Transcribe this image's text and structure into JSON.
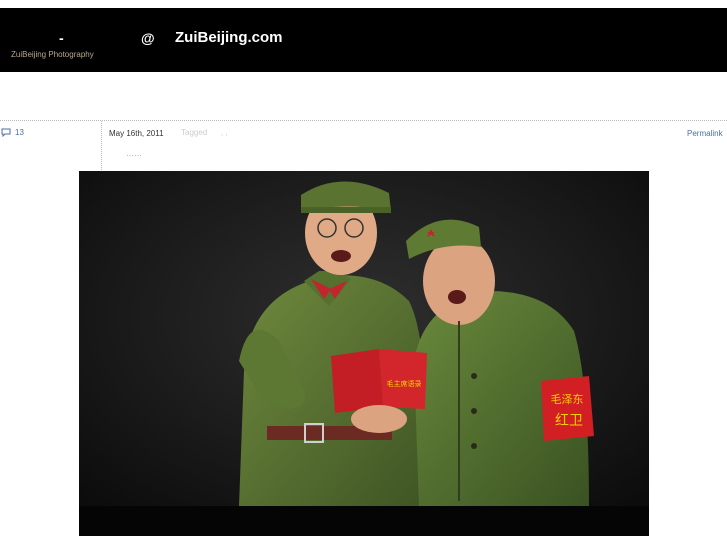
{
  "header": {
    "dash": "-",
    "subtitle": "ZuiBeijing Photography",
    "at": "@",
    "site_name": "ZuiBeijing.com"
  },
  "post": {
    "comment_count": "13",
    "date": "May 16th, 2011",
    "tagged_label": "Tagged",
    "tags_text": ", ,",
    "permalink": "Permalink",
    "excerpt": "……"
  },
  "photo": {
    "armband_text_1": "毛泽东",
    "armband_text_2": "红卫",
    "book_text": "毛主席语录"
  },
  "icons": {
    "comment": "comment-bubble-icon"
  }
}
